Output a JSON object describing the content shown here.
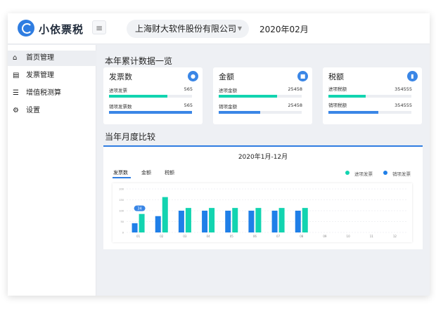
{
  "app": {
    "logo_text": "小依票税",
    "menu_toggle_icon": "menu-icon",
    "company": "上海财大软件股份有限公司",
    "period": "2020年02月"
  },
  "sidebar": {
    "items": [
      {
        "label": "首页管理",
        "icon": "home-icon",
        "active": true
      },
      {
        "label": "发票管理",
        "icon": "invoice-icon",
        "active": false
      },
      {
        "label": "增值税测算",
        "icon": "layers-icon",
        "active": false
      },
      {
        "label": "设置",
        "icon": "gear-icon",
        "active": false
      }
    ]
  },
  "summary": {
    "title": "本年累计数据一览",
    "cards": [
      {
        "title": "发票数",
        "icon": "circle-icon",
        "rows": [
          {
            "label": "进项发票",
            "value": "565",
            "fill": 0.7,
            "color": "#12d4b0"
          },
          {
            "label": "销项发票数",
            "value": "565",
            "fill": 1.0,
            "color": "#3a86e6"
          }
        ]
      },
      {
        "title": "金额",
        "icon": "lock-icon",
        "rows": [
          {
            "label": "进项金额",
            "value": "25458",
            "fill": 0.7,
            "color": "#12d4b0"
          },
          {
            "label": "销项金额",
            "value": "25458",
            "fill": 0.5,
            "color": "#3a86e6"
          }
        ]
      },
      {
        "title": "税额",
        "icon": "bookmark-icon",
        "rows": [
          {
            "label": "进项税额",
            "value": "354555",
            "fill": 0.45,
            "color": "#12d4b0"
          },
          {
            "label": "销项税额",
            "value": "354555",
            "fill": 0.6,
            "color": "#3a86e6"
          }
        ]
      }
    ]
  },
  "monthly": {
    "title": "当年月度比较",
    "chart_title": "2020年1月-12月",
    "tabs": [
      "发票数",
      "金额",
      "税额"
    ],
    "active_tab": 0,
    "legend": [
      {
        "label": "进项发票",
        "color": "#12d4b0"
      },
      {
        "label": "销项发票",
        "color": "#1f7fe8"
      }
    ]
  },
  "chart_data": {
    "type": "bar",
    "categories": [
      "01",
      "02",
      "03",
      "04",
      "05",
      "06",
      "07",
      "08",
      "09",
      "10",
      "11",
      "12"
    ],
    "series": [
      {
        "name": "进项发票",
        "color": "#12d4b0",
        "values": [
          34,
          65,
          45,
          45,
          45,
          45,
          45,
          45,
          null,
          null,
          null,
          null
        ]
      },
      {
        "name": "销项发票",
        "color": "#1f7fe8",
        "values": [
          17,
          30,
          40,
          40,
          40,
          40,
          40,
          40,
          null,
          null,
          null,
          null
        ]
      }
    ],
    "yticks": [
      "200",
      "150",
      "100",
      "50",
      "0"
    ],
    "ylim": [
      0,
      80
    ],
    "grid": true,
    "tooltip": {
      "category": "01",
      "value": "34"
    }
  }
}
